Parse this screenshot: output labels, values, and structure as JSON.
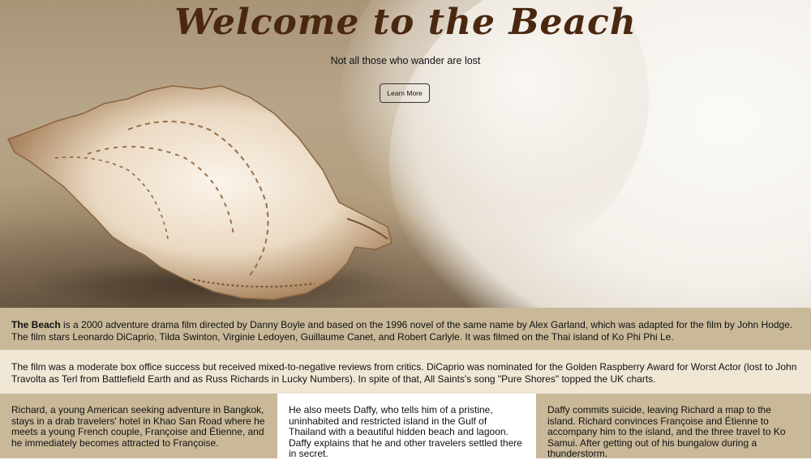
{
  "hero": {
    "title": "Welcome to the Beach",
    "subtitle": "Not all those who wander are lost",
    "button_label": "Learn More"
  },
  "intro": {
    "bold": "The Beach",
    "text": " is a 2000 adventure drama film directed by Danny Boyle and based on the 1996 novel of the same name by Alex Garland, which was adapted for the film by John Hodge. The film stars Leonardo DiCaprio, Tilda Swinton, Virginie Ledoyen, Guillaume Canet, and Robert Carlyle. It was filmed on the Thai island of Ko Phi Phi Le."
  },
  "reception": {
    "text": "The film was a moderate box office success but received mixed-to-negative reviews from critics. DiCaprio was nominated for the Golden Raspberry Award for Worst Actor (lost to John Travolta as Terl from Battlefield Earth and as Russ Richards in Lucky Numbers). In spite of that, All Saints's song \"Pure Shores\" topped the UK charts."
  },
  "columns": [
    {
      "text": "Richard, a young American seeking adventure in Bangkok, stays in a drab travelers' hotel in Khao San Road where he meets a young French couple, Françoise and Étienne, and he immediately becomes attracted to Françoise."
    },
    {
      "text": "He also meets Daffy, who tells him of a pristine, uninhabited and restricted island in the Gulf of Thailand with a beautiful hidden beach and lagoon. Daffy explains that he and other travelers settled there in secret."
    },
    {
      "text": "Daffy commits suicide, leaving Richard a map to the island. Richard convinces Françoise and Étienne to accompany him to the island, and the three travel to Ko Samui. After getting out of his bungalow during a thunderstorm."
    }
  ],
  "colors": {
    "title": "#4a2810",
    "band_tan": "#c9b999",
    "band_cream": "#f0e6d4"
  }
}
